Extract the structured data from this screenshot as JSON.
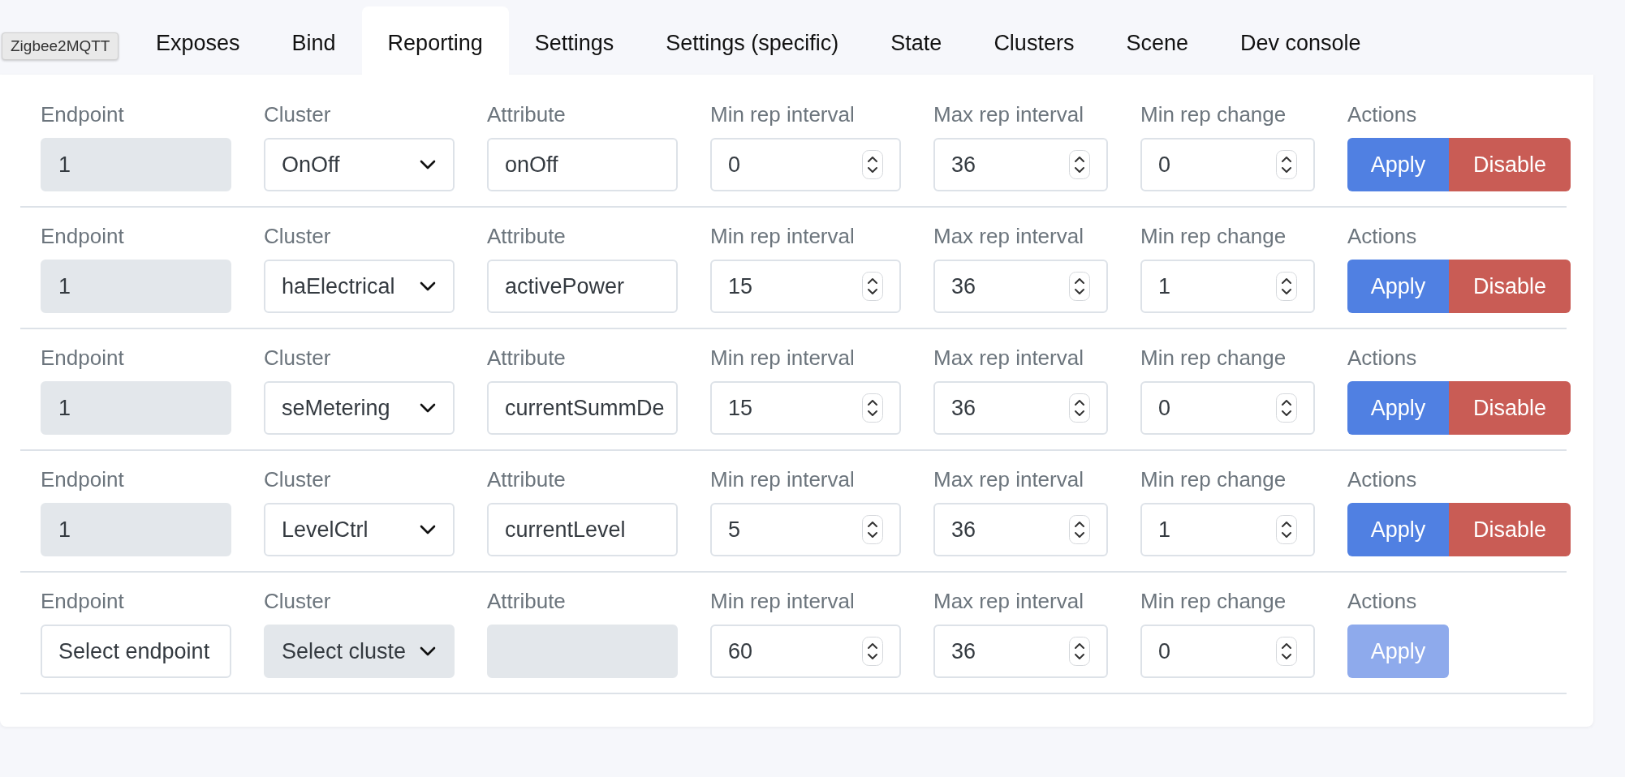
{
  "tooltip": "Zigbee2MQTT",
  "tabs": [
    {
      "label": "Exposes",
      "selected": false
    },
    {
      "label": "Bind",
      "selected": false
    },
    {
      "label": "Reporting",
      "selected": true
    },
    {
      "label": "Settings",
      "selected": false
    },
    {
      "label": "Settings (specific)",
      "selected": false
    },
    {
      "label": "State",
      "selected": false
    },
    {
      "label": "Clusters",
      "selected": false
    },
    {
      "label": "Scene",
      "selected": false
    },
    {
      "label": "Dev console",
      "selected": false
    }
  ],
  "rows": [
    {
      "labels": [
        "Endpoint",
        "Cluster",
        "Attribute",
        "Min rep interval",
        "Max rep interval",
        "Min rep change",
        "Actions"
      ],
      "endpoint": {
        "value": "1",
        "disabled": true
      },
      "cluster": {
        "value": "OnOff",
        "disabled": false
      },
      "attribute": {
        "value": "onOff",
        "disabled": false
      },
      "min_interval": "0",
      "max_interval": "36",
      "min_change": "0",
      "apply": {
        "label": "Apply",
        "disabled": false
      },
      "disable": "Disable"
    },
    {
      "labels": [
        "Endpoint",
        "Cluster",
        "Attribute",
        "Min rep interval",
        "Max rep interval",
        "Min rep change",
        "Actions"
      ],
      "endpoint": {
        "value": "1",
        "disabled": true
      },
      "cluster": {
        "value": "haElectrical",
        "disabled": false
      },
      "attribute": {
        "value": "activePower",
        "disabled": false
      },
      "min_interval": "15",
      "max_interval": "36",
      "min_change": "1",
      "apply": {
        "label": "Apply",
        "disabled": false
      },
      "disable": "Disable"
    },
    {
      "labels": [
        "Endpoint",
        "Cluster",
        "Attribute",
        "Min rep interval",
        "Max rep interval",
        "Min rep change",
        "Actions"
      ],
      "endpoint": {
        "value": "1",
        "disabled": true
      },
      "cluster": {
        "value": "seMetering",
        "disabled": false
      },
      "attribute": {
        "value": "currentSummDe",
        "disabled": false
      },
      "min_interval": "15",
      "max_interval": "36",
      "min_change": "0",
      "apply": {
        "label": "Apply",
        "disabled": false
      },
      "disable": "Disable"
    },
    {
      "labels": [
        "Endpoint",
        "Cluster",
        "Attribute",
        "Min rep interval",
        "Max rep interval",
        "Min rep change",
        "Actions"
      ],
      "endpoint": {
        "value": "1",
        "disabled": true
      },
      "cluster": {
        "value": "LevelCtrl",
        "disabled": false
      },
      "attribute": {
        "value": "currentLevel",
        "disabled": false
      },
      "min_interval": "5",
      "max_interval": "36",
      "min_change": "1",
      "apply": {
        "label": "Apply",
        "disabled": false
      },
      "disable": "Disable"
    },
    {
      "labels": [
        "Endpoint",
        "Cluster",
        "Attribute",
        "Min rep interval",
        "Max rep interval",
        "Min rep change",
        "Actions"
      ],
      "endpoint": {
        "value": "Select endpoint",
        "disabled": false
      },
      "cluster": {
        "value": "Select cluste",
        "disabled": true
      },
      "attribute": {
        "disabled": true
      },
      "min_interval": "60",
      "max_interval": "36",
      "min_change": "0",
      "apply": {
        "label": "Apply",
        "disabled": true
      }
    }
  ]
}
